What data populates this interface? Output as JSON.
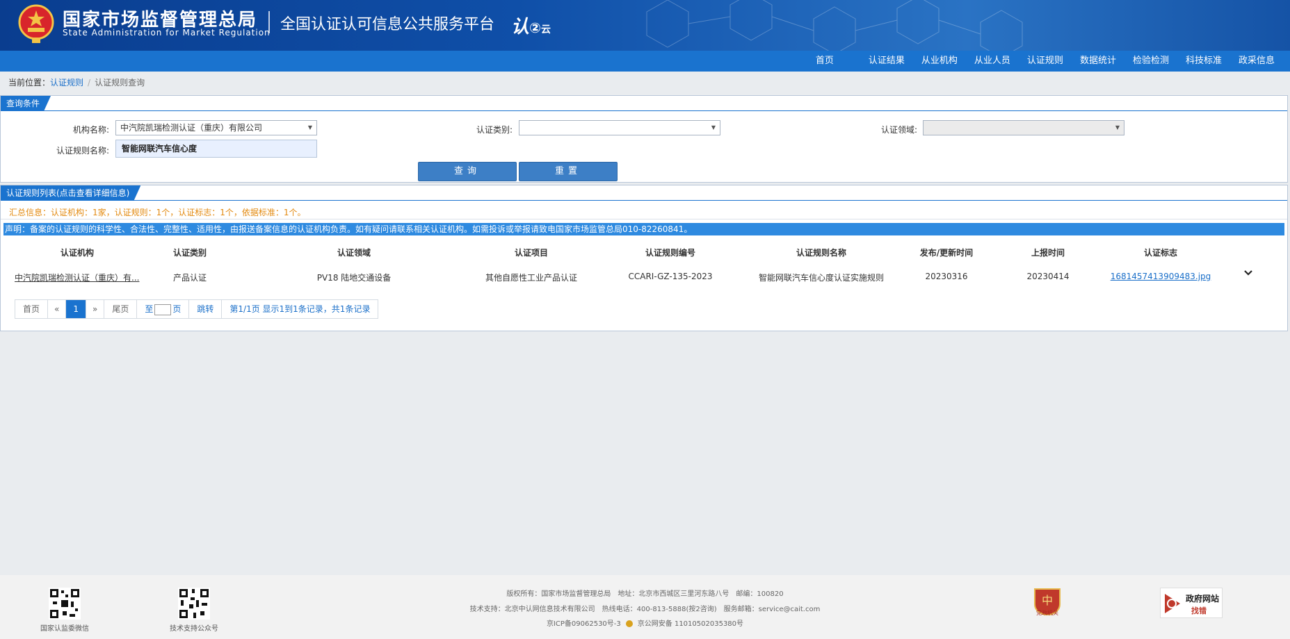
{
  "header": {
    "org_cn": "国家市场监督管理总局",
    "org_en": "State Administration for Market Regulation",
    "platform": "全国认证认可信息公共服务平台",
    "logo_main": "认",
    "logo_sub": "云"
  },
  "nav": {
    "items": [
      "首页",
      "认证结果",
      "从业机构",
      "从业人员",
      "认证规则",
      "数据统计",
      "检验检测",
      "科技标准",
      "政采信息"
    ]
  },
  "breadcrumb": {
    "prefix": "当前位置：",
    "link": "认证规则",
    "separator": "/",
    "current": "认证规则查询"
  },
  "query": {
    "title": "查询条件",
    "org_label": "机构名称:",
    "org_value": "中汽院凯瑞检测认证（重庆）有限公司",
    "category_label": "认证类别:",
    "category_value": "",
    "domain_label": "认证领域:",
    "domain_value": "",
    "rule_name_label": "认证规则名称:",
    "rule_name_value": "智能网联汽车信心度",
    "search_button": "查询",
    "reset_button": "重置"
  },
  "results": {
    "title": "认证规则列表(点击查看详细信息)",
    "summary": "汇总信息：认证机构：1家，认证规则：1个，认证标志：1个，依据标准：1个。",
    "notice": "声明：备案的认证规则的科学性、合法性、完整性、适用性，由报送备案信息的认证机构负责。如有疑问请联系相关认证机构。如需投诉或举报请致电国家市场监管总局010-82260841。",
    "columns": [
      "认证机构",
      "认证类别",
      "认证领域",
      "认证项目",
      "认证规则编号",
      "认证规则名称",
      "发布/更新时间",
      "上报时间",
      "认证标志"
    ],
    "rows": [
      {
        "org": "中汽院凯瑞检测认证（重庆）有...",
        "category": "产品认证",
        "domain": "PV18 陆地交通设备",
        "project": "其他自愿性工业产品认证",
        "rule_no": "CCARI-GZ-135-2023",
        "rule_name": "智能网联汽车信心度认证实施规则",
        "publish_date": "20230316",
        "report_date": "20230414",
        "mark": "1681457413909483.jpg"
      }
    ]
  },
  "pager": {
    "first": "首页",
    "prev": "«",
    "current": "1",
    "next": "»",
    "last": "尾页",
    "goto_prefix": "至",
    "goto_suffix": "页",
    "jump": "跳转",
    "info": "第1/1页  显示1到1条记录，共1条记录"
  },
  "footer": {
    "qr1_label": "国家认监委微信",
    "qr2_label": "技术支持公众号",
    "line1": [
      "版权所有：国家市场监督管理总局",
      "地址：北京市西城区三里河东路八号",
      "邮编：100820"
    ],
    "line2": [
      "技术支持：北京中认网信息技术有限公司",
      "热线电话：400-813-5888(按2咨询)",
      "服务邮箱：service@cait.com"
    ],
    "line3": [
      "京ICP备09062530号-3",
      "京公网安备 11010502035380号"
    ],
    "badge1_label": "党政机关",
    "badge2_title": "政府网站",
    "badge2_sub": "找错"
  },
  "colors": {
    "nav_blue": "#1a73cf",
    "header_blue": "#0f4fa8",
    "summary_orange": "#e38a10",
    "link_blue": "#1a6fc9"
  }
}
